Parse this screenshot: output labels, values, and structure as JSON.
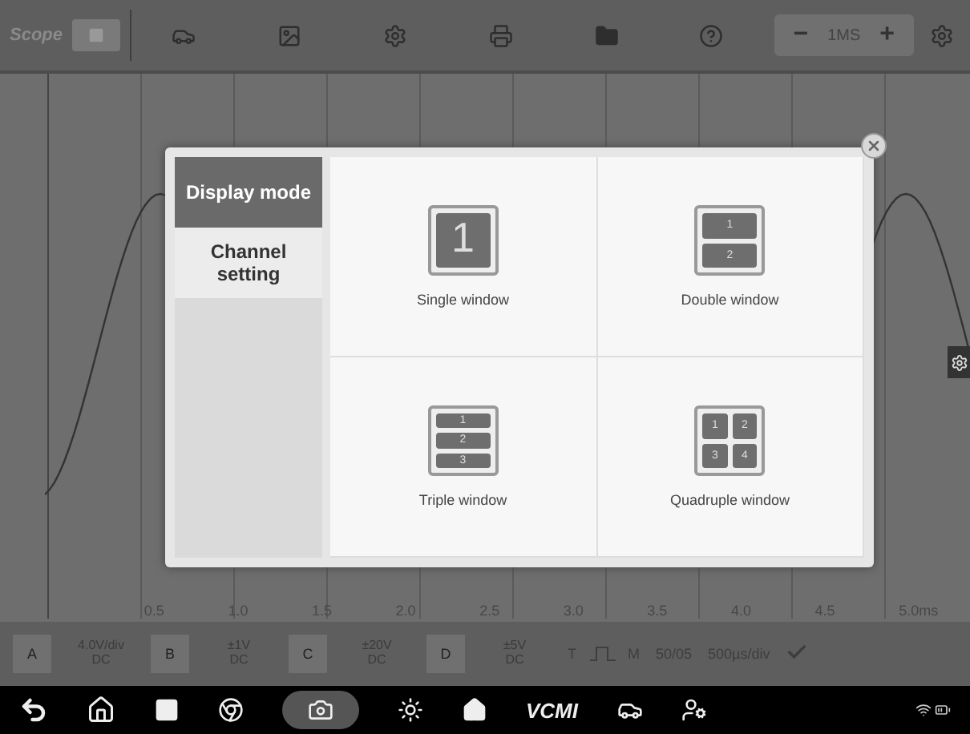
{
  "toolbar": {
    "title": "Scope",
    "timebase": {
      "minus": "−",
      "value": "1MS",
      "plus": "+"
    }
  },
  "graph": {
    "x_labels": [
      "0.5",
      "1.0",
      "1.5",
      "2.0",
      "2.5",
      "3.0",
      "3.5",
      "4.0",
      "4.5",
      "5.0ms"
    ]
  },
  "dialog": {
    "menu": [
      {
        "label": "Display mode",
        "selected": true
      },
      {
        "label": "Channel setting",
        "selected": false
      }
    ],
    "modes": [
      {
        "label": "Single window",
        "kind": "single",
        "panes": [
          "1"
        ]
      },
      {
        "label": "Double window",
        "kind": "stack",
        "panes": [
          "1",
          "2"
        ]
      },
      {
        "label": "Triple window",
        "kind": "stack",
        "panes": [
          "1",
          "2",
          "3"
        ]
      },
      {
        "label": "Quadruple window",
        "kind": "grid",
        "panes": [
          "1",
          "2",
          "3",
          "4"
        ]
      }
    ]
  },
  "channels": [
    {
      "letter": "A",
      "range": "4.0V/div",
      "coupling": "DC"
    },
    {
      "letter": "B",
      "range": "±1V",
      "coupling": "DC"
    },
    {
      "letter": "C",
      "range": "±20V",
      "coupling": "DC"
    },
    {
      "letter": "D",
      "range": "±5V",
      "coupling": "DC"
    }
  ],
  "controls": {
    "trigger": "T",
    "memory": "M",
    "frames": "50/05",
    "timebase": "500µs/div"
  },
  "navbar": {
    "vci": "VCMI"
  }
}
